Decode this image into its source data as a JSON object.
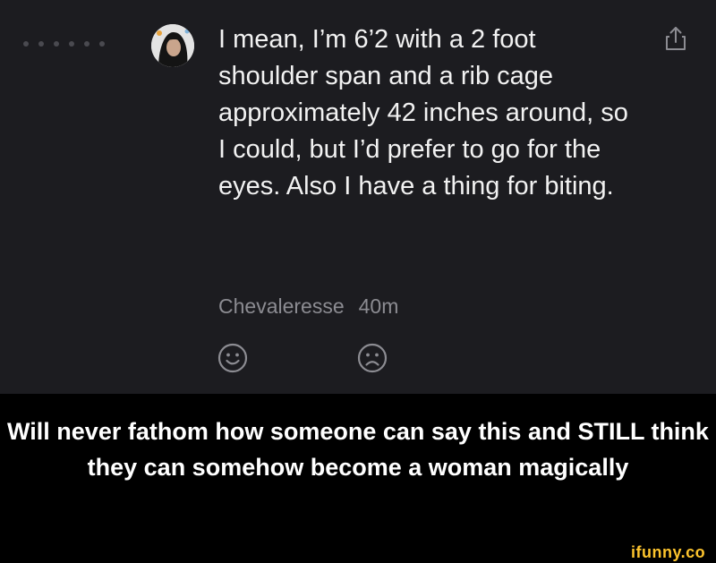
{
  "post": {
    "body": "I mean, I’m 6’2 with a 2 foot shoulder span and a rib cage approximately 42 inches around, so I could, but I’d prefer to go for the eyes. Also I have a thing for biting.",
    "author": "Chevaleresse",
    "time": "40m",
    "icons": [
      "avatar",
      "share-icon",
      "smile-icon",
      "frown-icon"
    ]
  },
  "caption": "Will never fathom how someone can say this and STILL think they can somehow become a woman magically",
  "watermark": "ifunny.co",
  "colors": {
    "post_bg": "#1c1c20",
    "text": "#f2f2f2",
    "meta": "#8c8c92",
    "caption_bg": "#000000",
    "watermark": "#fdc42d"
  }
}
